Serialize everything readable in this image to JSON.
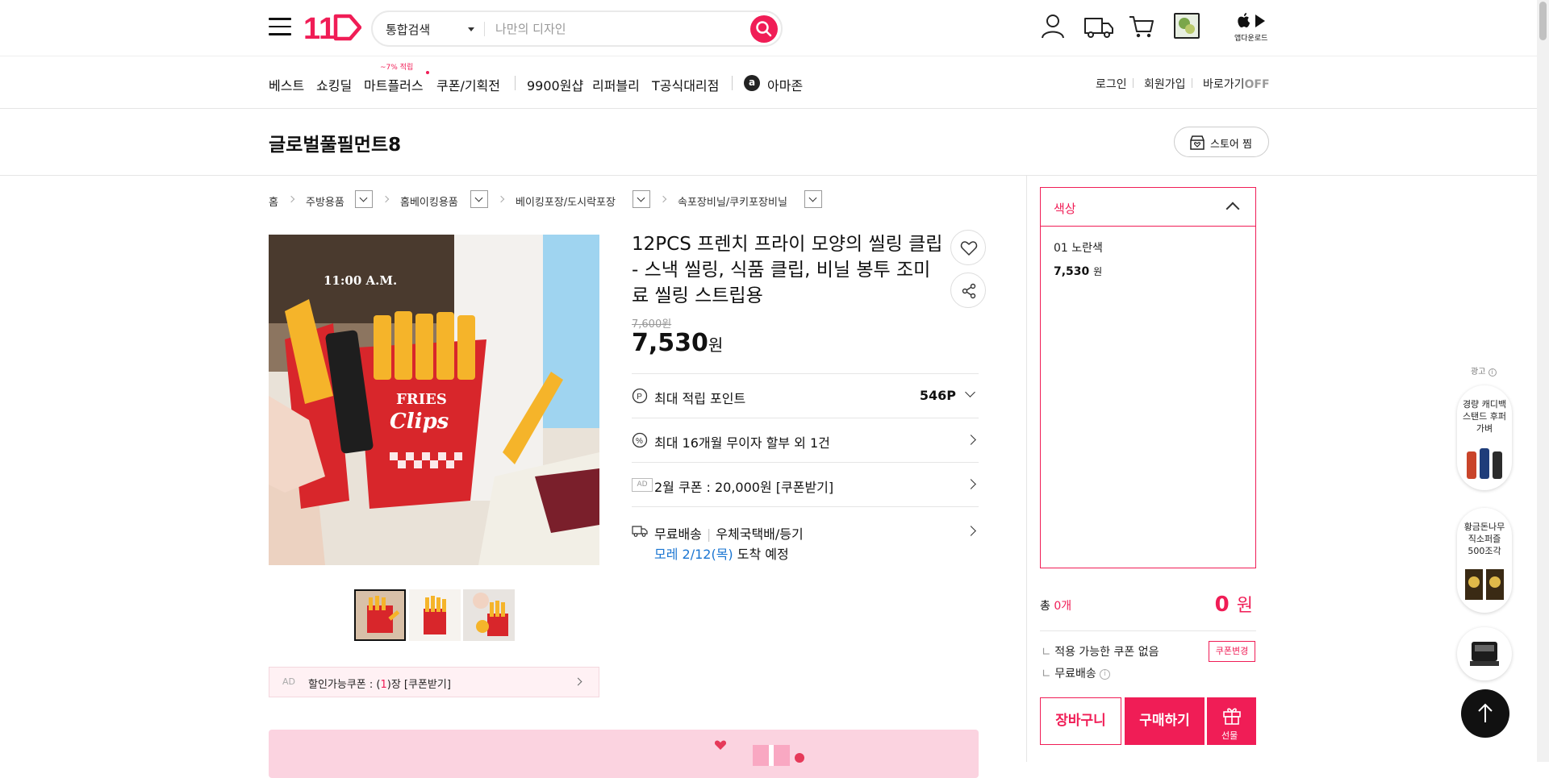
{
  "header": {
    "logo_text": "11",
    "search_category": "통합검색",
    "search_placeholder": "나만의 디자인",
    "app_download": "앱다운로드"
  },
  "nav": {
    "items": [
      "베스트",
      "쇼킹딜",
      "마트플러스",
      "쿠폰/기획전",
      "9900원샵",
      "리퍼블리",
      "T공식대리점",
      "아마존"
    ],
    "mart_badge": "~7% 적립",
    "amazon_icon_letter": "a",
    "right": {
      "login": "로그인",
      "join": "회원가입",
      "shortcut": "바로가기",
      "shortcut_state": "OFF"
    }
  },
  "seller": {
    "name": "글로벌풀필먼트8",
    "store_button": "스토어 찜"
  },
  "breadcrumb": [
    "홈",
    "주방용품",
    "홈베이킹용품",
    "베이킹포장/도시락포장",
    "속포장비닐/쿠키포장비닐"
  ],
  "product": {
    "image_caption": "11:00 A.M.",
    "image_text_1": "FRIES",
    "image_text_2": "Clips",
    "title": "12PCS 프렌치 프라이 모양의 씰링 클립 - 스낵 씰링, 식품 클립, 비닐 봉투 조미료 씰링 스트립용",
    "original_price": "7,600원",
    "price": "7,530",
    "price_unit": "원",
    "points_label": "최대 적립 포인트",
    "points_value": "546P",
    "installment": "최대 16개월 무이자 할부 외 1건",
    "coupon_ad_tag": "AD",
    "coupon": "2월 쿠폰 : 20,000원 [쿠폰받기]",
    "shipping_label": "무료배송",
    "shipping_method": "우체국택배/등기",
    "arrival_date": "모레 2/12(목)",
    "arrival_suffix": "도착 예정",
    "discount_ad": "AD",
    "discount_prefix": "할인가능쿠폰 : (",
    "discount_count": "1",
    "discount_suffix": ")장 [쿠폰받기]"
  },
  "options": {
    "header": "색상",
    "item_name": "01 노란색",
    "item_price": "7,530",
    "item_unit": "원"
  },
  "summary": {
    "total_label_prefix": "총 ",
    "total_count": "0개",
    "total_amount": "0",
    "total_unit": "원",
    "coupon_line": "적용 가능한 쿠폰 없음",
    "coupon_change": "쿠폰변경",
    "shipping_line": "무료배송"
  },
  "buttons": {
    "cart": "장바구니",
    "buy": "구매하기",
    "gift": "선물"
  },
  "side_ads": {
    "label": "광고",
    "ad1": "경량 캐디백 스탠드 후퍼 가벼",
    "ad2": "황금돈나무 직소퍼즐 500조각"
  },
  "colors": {
    "brand": "#f01d56",
    "link_blue": "#1a75d2"
  }
}
